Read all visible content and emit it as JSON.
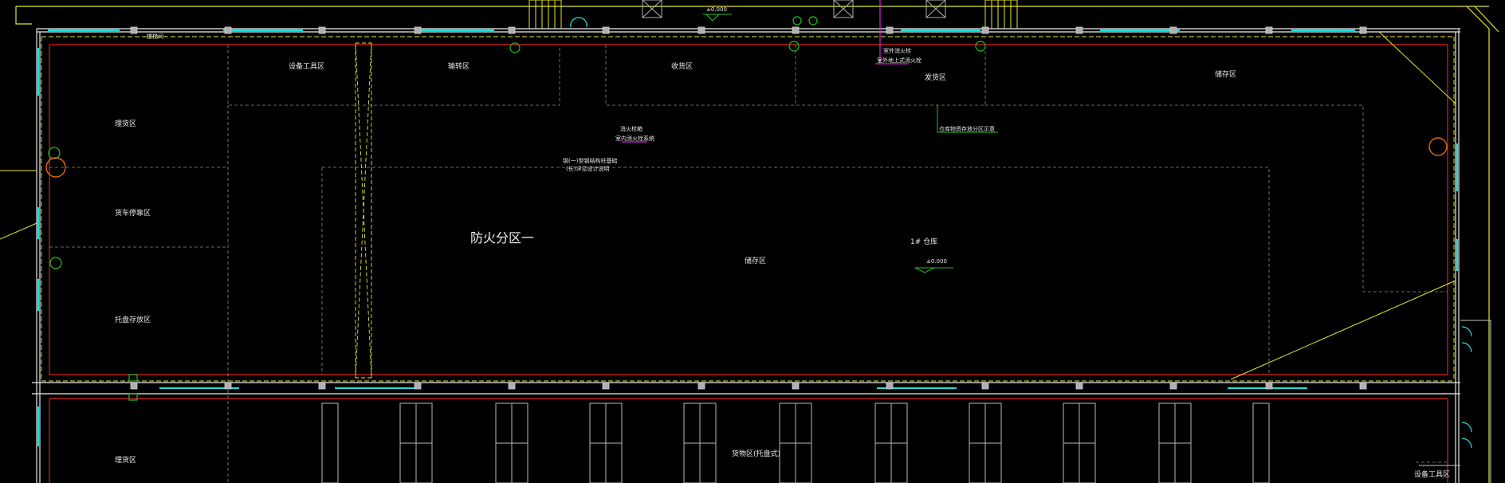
{
  "colors": {
    "background": "#000000",
    "outer_boundary": "#e6e62e",
    "wall": "#c8c8c8",
    "fire_line": "#e02020",
    "zone_dash": "#8a8a8a",
    "cyan": "#20e0e0",
    "green": "#20c020",
    "magenta": "#e020e0",
    "orange": "#e06a10"
  },
  "zones": {
    "equipment_tools_top": "设备工具区",
    "transfer": "输转区",
    "receiving": "收货区",
    "shipping": "发货区",
    "storage_top_right": "储存区",
    "tally_left": "理货区",
    "truck_parking": "货车停靠区",
    "pallet_area": "托盘存放区",
    "fire_zone": "防火分区一",
    "storage_center": "储存区",
    "warehouse_label": "1# 仓库",
    "tally_bottom": "理货区",
    "cargo_bottom": "货物区(托盘式)",
    "equipment_bottom_right": "设备工具区"
  },
  "annotations": {
    "elev_top": "±0.000",
    "elev_center": "±0.000",
    "top_left_tag": "楼梯间",
    "magenta_note_1": "室外消火栓",
    "magenta_note_2": "室外地上式消火栓",
    "center_note_1": "消火栓箱",
    "center_note_2": "室内消火栓系统",
    "floor_note_1": "钢(一)型钢结构柱基础",
    "floor_note_2": "(长)详见设计说明",
    "green_callout": "仓库物资存放分区示意"
  }
}
